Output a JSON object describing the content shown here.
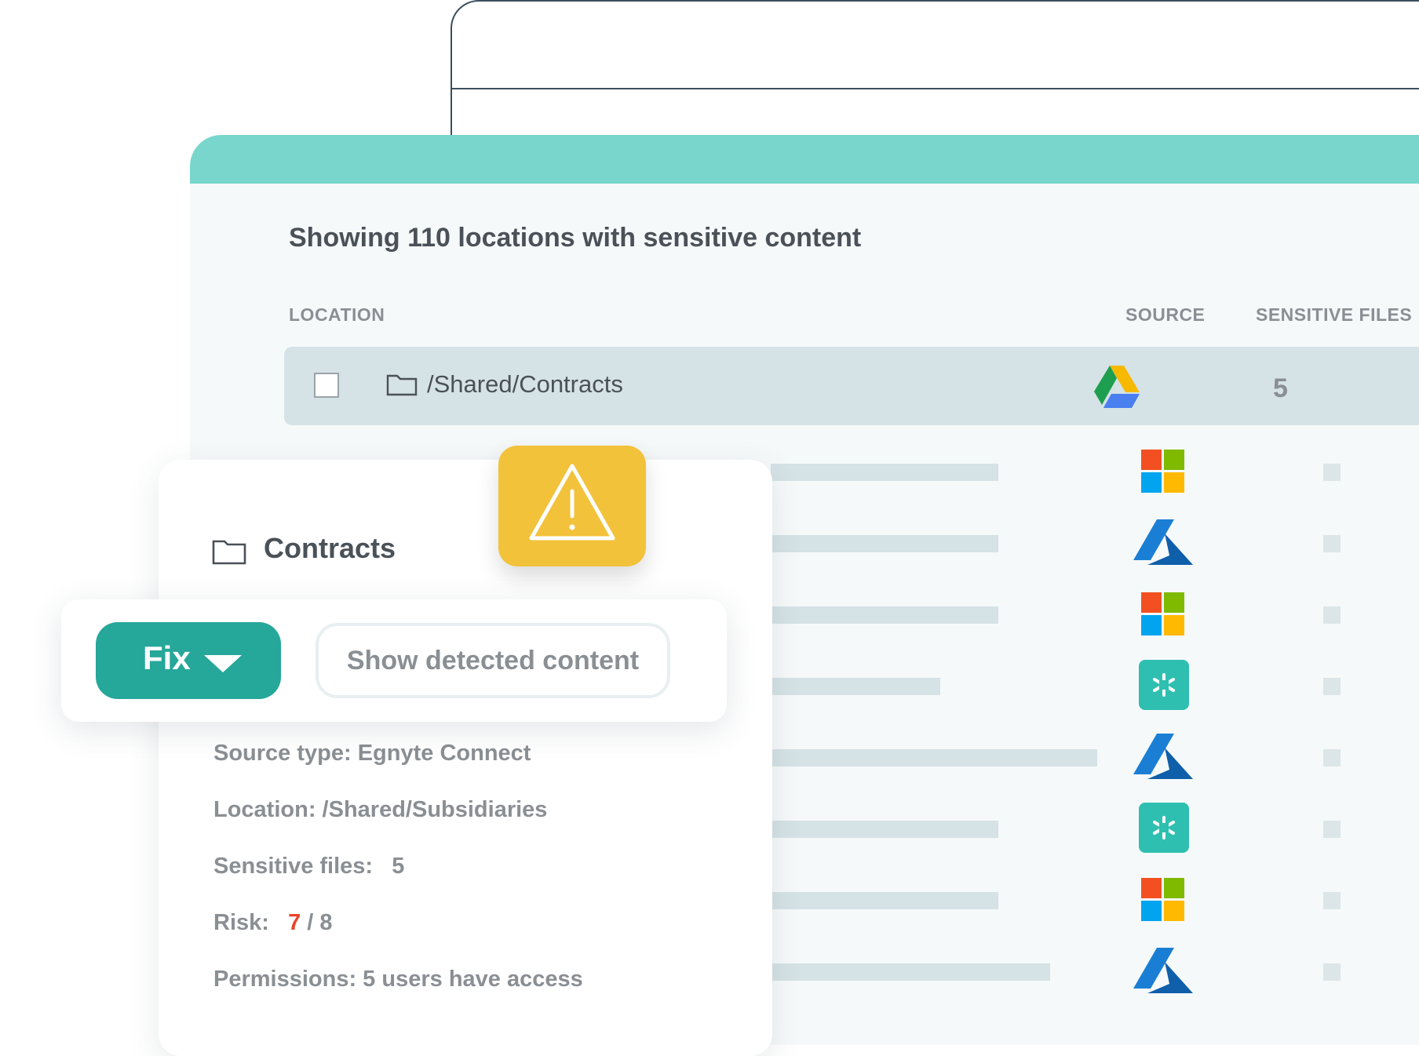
{
  "main": {
    "heading": "Showing 110 locations with sensitive content",
    "columns": {
      "location": "LOCATION",
      "source": "SOURCE",
      "sensitive_files": "SENSITIVE FILES"
    },
    "highlight_row": {
      "path": "/Shared/Contracts",
      "source_icon": "google-drive-icon",
      "count": "5"
    },
    "rows": [
      {
        "source_icon": "microsoft-icon"
      },
      {
        "source_icon": "azure-icon"
      },
      {
        "source_icon": "microsoft-icon"
      },
      {
        "source_icon": "egnyte-icon"
      },
      {
        "source_icon": "azure-icon"
      },
      {
        "source_icon": "egnyte-icon"
      },
      {
        "source_icon": "microsoft-icon"
      },
      {
        "source_icon": "azure-icon"
      }
    ]
  },
  "card": {
    "title": "Contracts",
    "warning_icon": "warning-icon",
    "fix_label": "Fix",
    "show_label": "Show detected content",
    "source_type": "Source type: Egnyte Connect",
    "location": "Location: /Shared/Subsidiaries",
    "sensitive_files_label": "Sensitive files:",
    "sensitive_files_value": "5",
    "risk_label": "Risk:",
    "risk_value": "7",
    "risk_total": "/ 8",
    "permissions": "Permissions: 5 users have access"
  },
  "colors": {
    "accent": "#25a79a",
    "topbar": "#78d6cd",
    "warning": "#f2c23a",
    "risk": "#e8452c"
  }
}
